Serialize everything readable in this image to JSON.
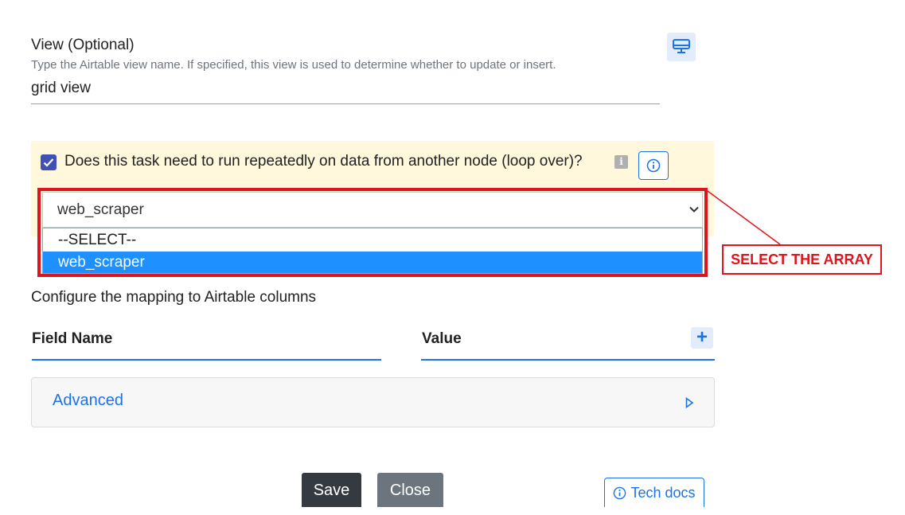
{
  "view_field": {
    "label": "View (Optional)",
    "help_text": "Type the Airtable view name. If specified, this view is used to determine whether to update or insert.",
    "value": "grid view",
    "icon": "monitor-icon"
  },
  "loop": {
    "checked": true,
    "question": "Does this task need to run repeatedly on data from another node (loop over)?",
    "hint_icon": "i",
    "info_icon": "info-icon"
  },
  "source_select": {
    "selected": "web_scraper",
    "options": [
      "--SELECT--",
      "web_scraper"
    ]
  },
  "annotation": {
    "text": "SELECT THE ARRAY",
    "color": "#e0141e"
  },
  "mapping": {
    "label": "Configure the mapping to Airtable columns",
    "field_header": "Field Name",
    "value_header": "Value",
    "add_symbol": "+"
  },
  "advanced": {
    "label": "Advanced"
  },
  "footer": {
    "save_label": "Save",
    "close_label": "Close",
    "techdocs_label": "Tech docs"
  },
  "colors": {
    "accent": "#1a73e8",
    "selected_option": "#1e90ff",
    "loop_panel": "#fff8dc"
  }
}
